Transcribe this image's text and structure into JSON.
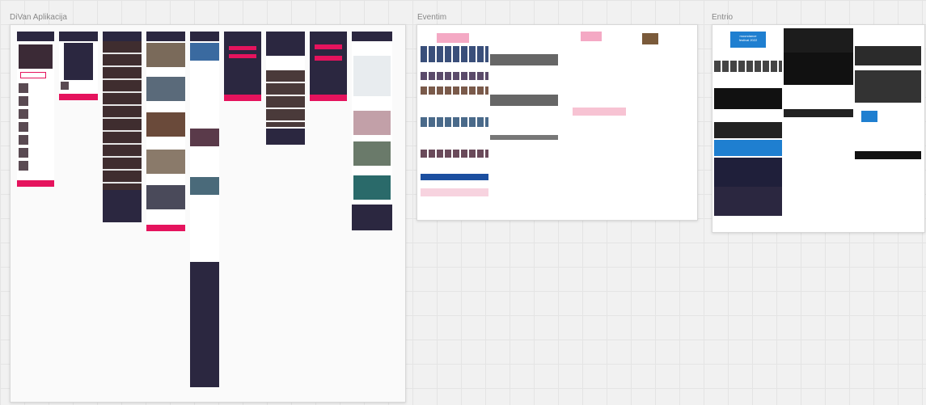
{
  "boards": [
    {
      "title": "DiVan Aplikacija"
    },
    {
      "title": "Eventim"
    },
    {
      "title": "Entrio"
    }
  ],
  "entrio": {
    "banner_line1": "moondance",
    "banner_line2": "festival 2022"
  },
  "colors": {
    "canvas": "#f1f1f1",
    "brand_pink": "#e5135d",
    "brand_dark": "#2b2740",
    "eventim_blue": "#1b4fa0",
    "entrio_blue": "#1f7fd0"
  }
}
